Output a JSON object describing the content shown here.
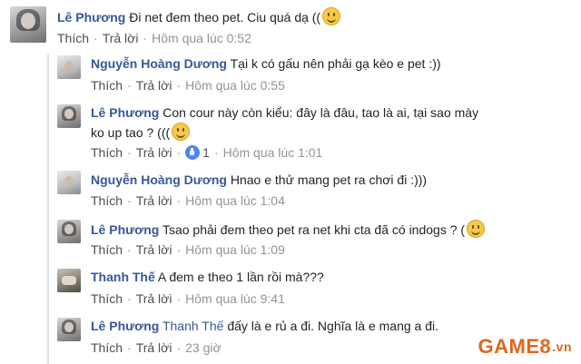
{
  "actions": {
    "like_label": "Thích",
    "reply_label": "Trả lời",
    "separator": "·"
  },
  "comments": [
    {
      "author": "Lê Phương",
      "text": "Đi net đem theo pet. Ciu quá dạ ((",
      "emoji": "smile-emoji",
      "time": "Hôm qua lúc 0:52"
    },
    {
      "author": "Nguyễn Hoàng Dương",
      "text": "Tại k có gấu nên phải gạ kèo e pet :))",
      "time": "Hôm qua lúc 0:55"
    },
    {
      "author": "Lê Phương",
      "text": "Con cour này còn kiểu: đây là đâu, tao là ai, tại sao mày",
      "text_line2": "ko up tao ? (((",
      "emoji": "smile-emoji",
      "like_count": "1",
      "time": "Hôm qua lúc 1:01"
    },
    {
      "author": "Nguyễn Hoàng Dương",
      "text": "Hnao e thử mang pet ra chơi đi :)))",
      "time": "Hôm qua lúc 1:04"
    },
    {
      "author": "Lê Phương",
      "text": "Tsao phải đem theo pet ra net khi cta đã có indogs ? (",
      "emoji": "smile-emoji",
      "time": "Hôm qua lúc 1:09"
    },
    {
      "author": "Thanh Thế",
      "text": "A đem e theo 1 lần rồi mà???",
      "time": "Hôm qua lúc 9:41"
    },
    {
      "author": "Lê Phương",
      "mention": "Thanh Thế",
      "text": "đấy là e rủ a đi. Nghĩa là e mang a đi.",
      "time": "23 giờ"
    }
  ],
  "watermark": {
    "brand": "GAME8",
    "suffix": ".vn"
  }
}
